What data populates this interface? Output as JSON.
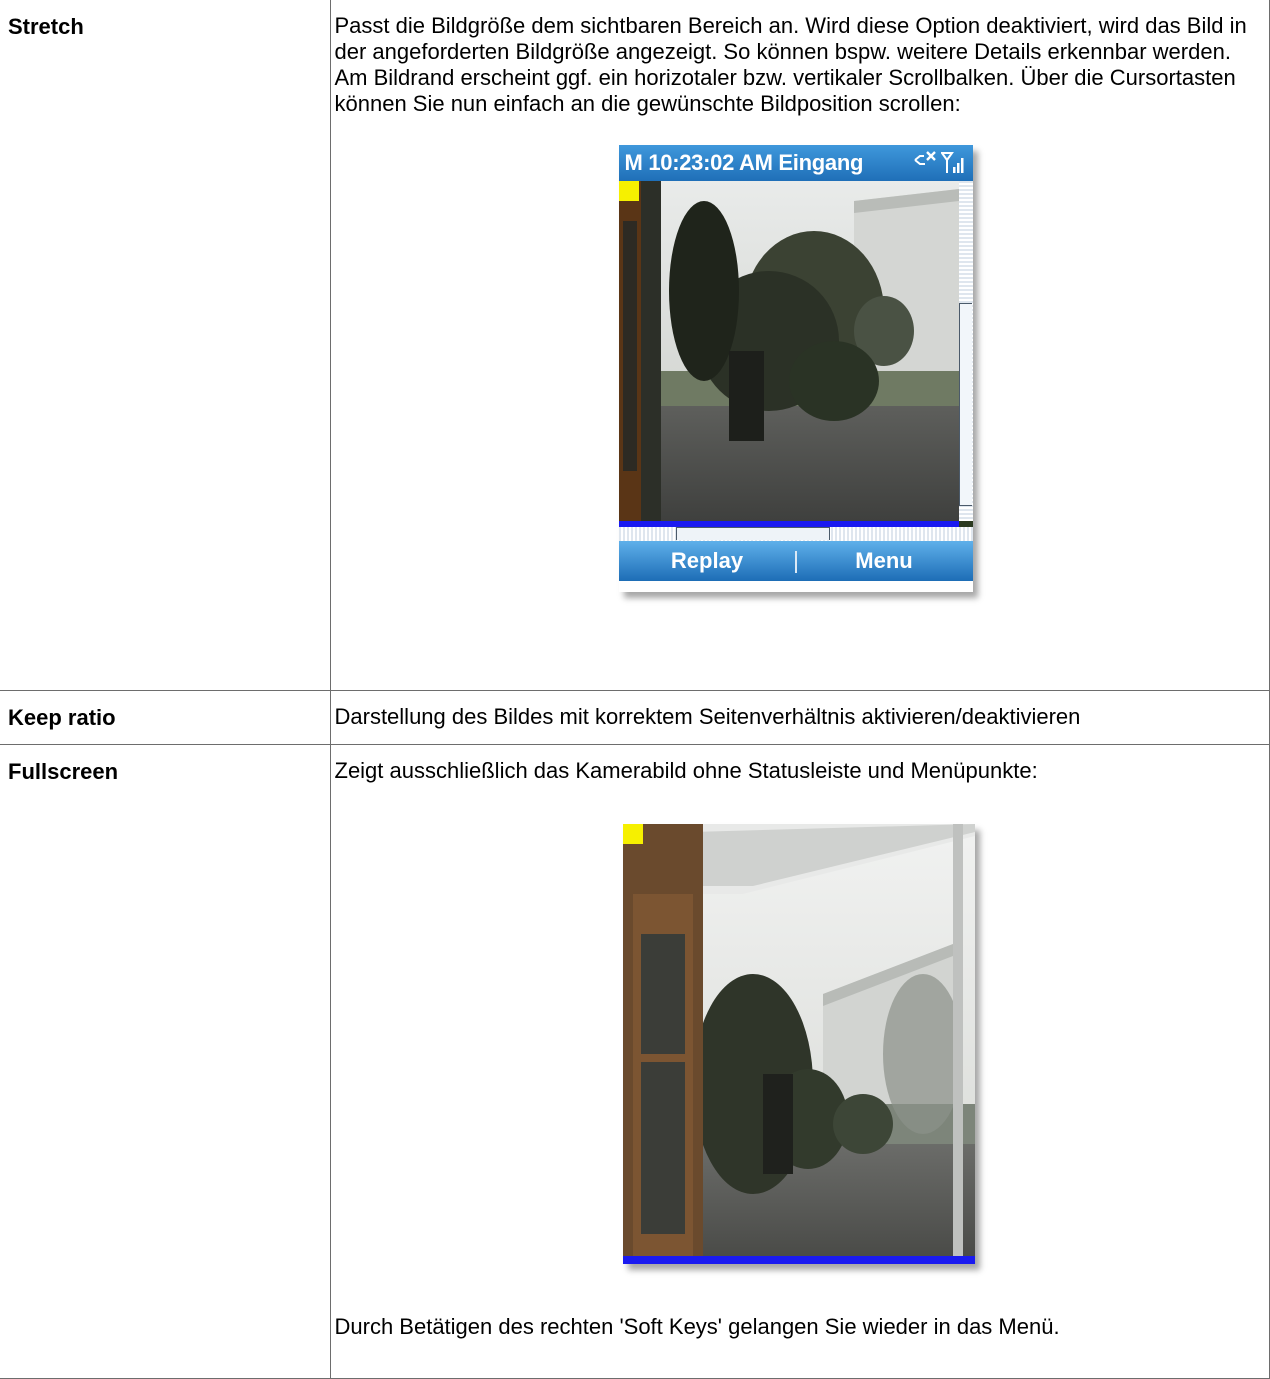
{
  "rows": [
    {
      "term": "Stretch",
      "description": "Passt die Bildgröße dem sichtbaren Bereich an. Wird diese Option deaktiviert, wird das Bild in der angeforderten Bildgröße angezeigt. So können bspw. weitere Details erkennbar werden. Am Bildrand erscheint ggf. ein horizotaler bzw. vertikaler Scrollbalken. Über die Cursortasten können Sie nun einfach an die gewünschte Bildposition scrollen:"
    },
    {
      "term": "Keep ratio",
      "description": "Darstellung des Bildes mit korrektem Seitenverhältnis aktivieren/deaktivieren"
    },
    {
      "term": "Fullscreen",
      "description": "Zeigt ausschließlich das Kamerabild ohne Statusleiste und Menüpunkte:",
      "footer": "Durch Betätigen des rechten 'Soft Keys' gelangen Sie wieder in das Menü."
    }
  ],
  "phone_stretch": {
    "status_text": "M 10:23:02 AM Eingang",
    "left_soft_key": "Replay",
    "right_soft_key": "Menu",
    "icons": [
      "network-disconnected-icon",
      "signal-strength-icon"
    ],
    "vertical_scroll_fraction": 0.36,
    "horizontal_scroll_fraction": 0.16
  },
  "phone_fullscreen": {
    "icons": []
  },
  "colors": {
    "status_bar": "#2f84cc",
    "marker": "#f6f000",
    "bottom_line": "#1a1af0"
  }
}
